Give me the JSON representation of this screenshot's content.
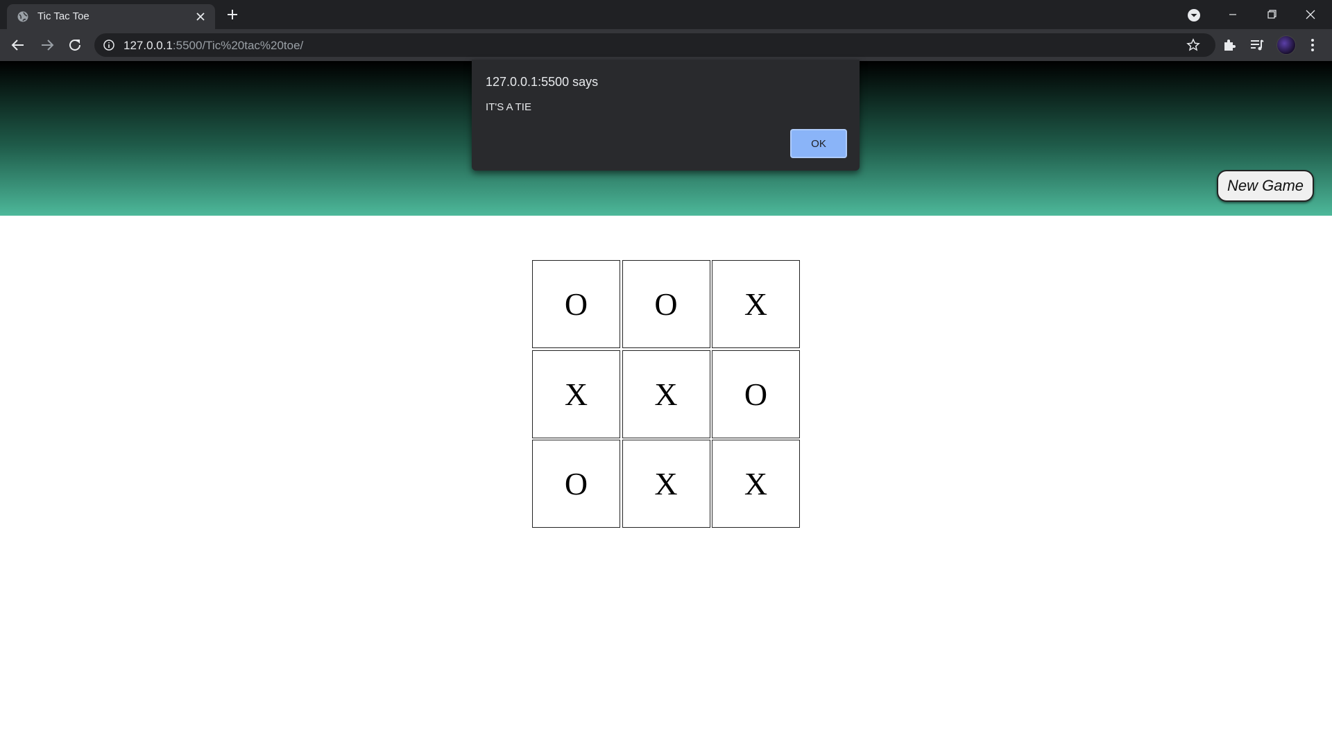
{
  "browser": {
    "tab": {
      "title": "Tic Tac Toe"
    },
    "url": {
      "host": "127.0.0.1",
      "rest": ":5500/Tic%20tac%20toe/"
    }
  },
  "page": {
    "new_game_label": "New Game",
    "board": [
      [
        "O",
        "O",
        "X"
      ],
      [
        "X",
        "X",
        "O"
      ],
      [
        "O",
        "X",
        "X"
      ]
    ]
  },
  "dialog": {
    "title": "127.0.0.1:5500 says",
    "message": "IT'S A TIE",
    "ok_label": "OK"
  },
  "colors": {
    "chrome_dark": "#202124",
    "toolbar": "#35363a",
    "header_gradient_top": "#000000",
    "header_gradient_bottom": "#4db89a",
    "dialog_bg": "#292a2d",
    "ok_button": "#8ab4f8"
  },
  "icons": [
    "globe-icon",
    "close-icon",
    "plus-icon",
    "tab-search-icon",
    "minimize-icon",
    "restore-icon",
    "window-close-icon",
    "back-arrow-icon",
    "forward-arrow-icon",
    "reload-icon",
    "info-icon",
    "star-icon",
    "puzzle-icon",
    "media-icon",
    "kebab-menu-icon"
  ]
}
